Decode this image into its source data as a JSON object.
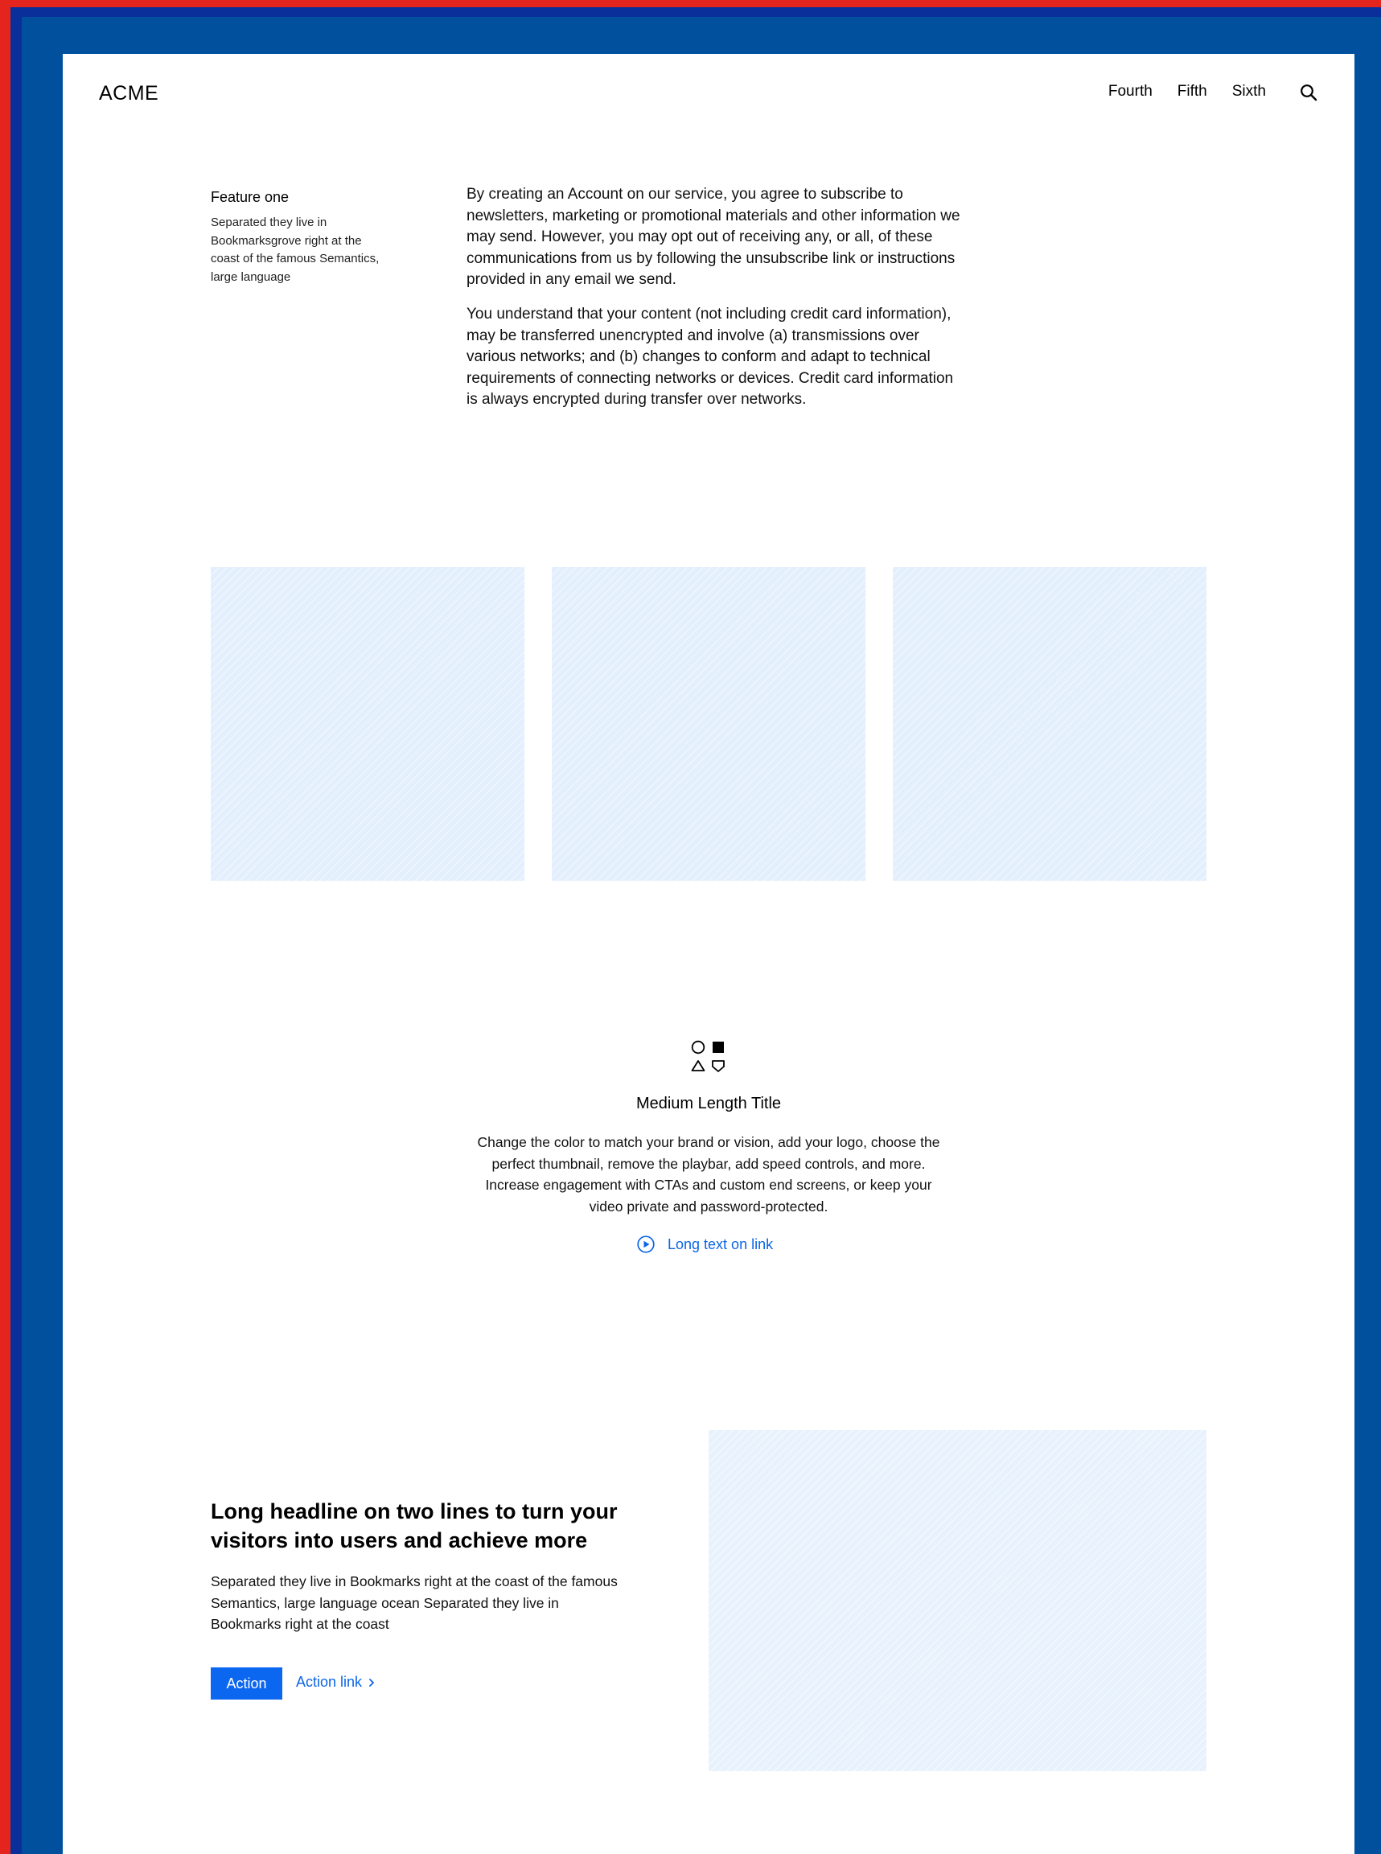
{
  "header": {
    "logo": "ACME",
    "nav": [
      "Fourth",
      "Fifth",
      "Sixth"
    ]
  },
  "feature": {
    "title": "Feature one",
    "description": "Separated they live in Bookmarksgrove right at the coast of the famous Semantics, large language"
  },
  "legal": {
    "paragraph1": "By creating an Account on our service, you agree to subscribe to newsletters, marketing or promotional materials and other information we may send. However, you may opt out of receiving any, or all, of these communications from us by following the unsubscribe link or instructions provided in any email we send.",
    "paragraph2": "You understand that your content (not including credit card information), may be transferred unencrypted and involve (a) transmissions over various networks; and (b) changes to conform and adapt to technical requirements of connecting networks or devices. Credit card information is always encrypted during transfer over networks."
  },
  "center": {
    "title": "Medium Length Title",
    "text": "Change the color to match your brand or vision, add your logo, choose the perfect thumbnail, remove the playbar, add speed controls, and more. Increase engagement with CTAs and custom end screens, or keep your video private and password-protected.",
    "link": "Long text on link"
  },
  "promo": {
    "headline": "Long headline on two lines to turn your visitors into users and achieve more",
    "body": "Separated they live in Bookmarks right at the coast of the famous Semantics, large language ocean Separated they live in Bookmarks right at the coast",
    "action_label": "Action",
    "action_link": "Action link"
  },
  "colors": {
    "frame_red": "#e3251e",
    "frame_blue": "#00509e",
    "accent": "#0b66f0",
    "placeholder": "#e3effd"
  },
  "icons": [
    "search-icon",
    "play-circle-icon",
    "chevron-right-icon",
    "shapes-icon"
  ]
}
